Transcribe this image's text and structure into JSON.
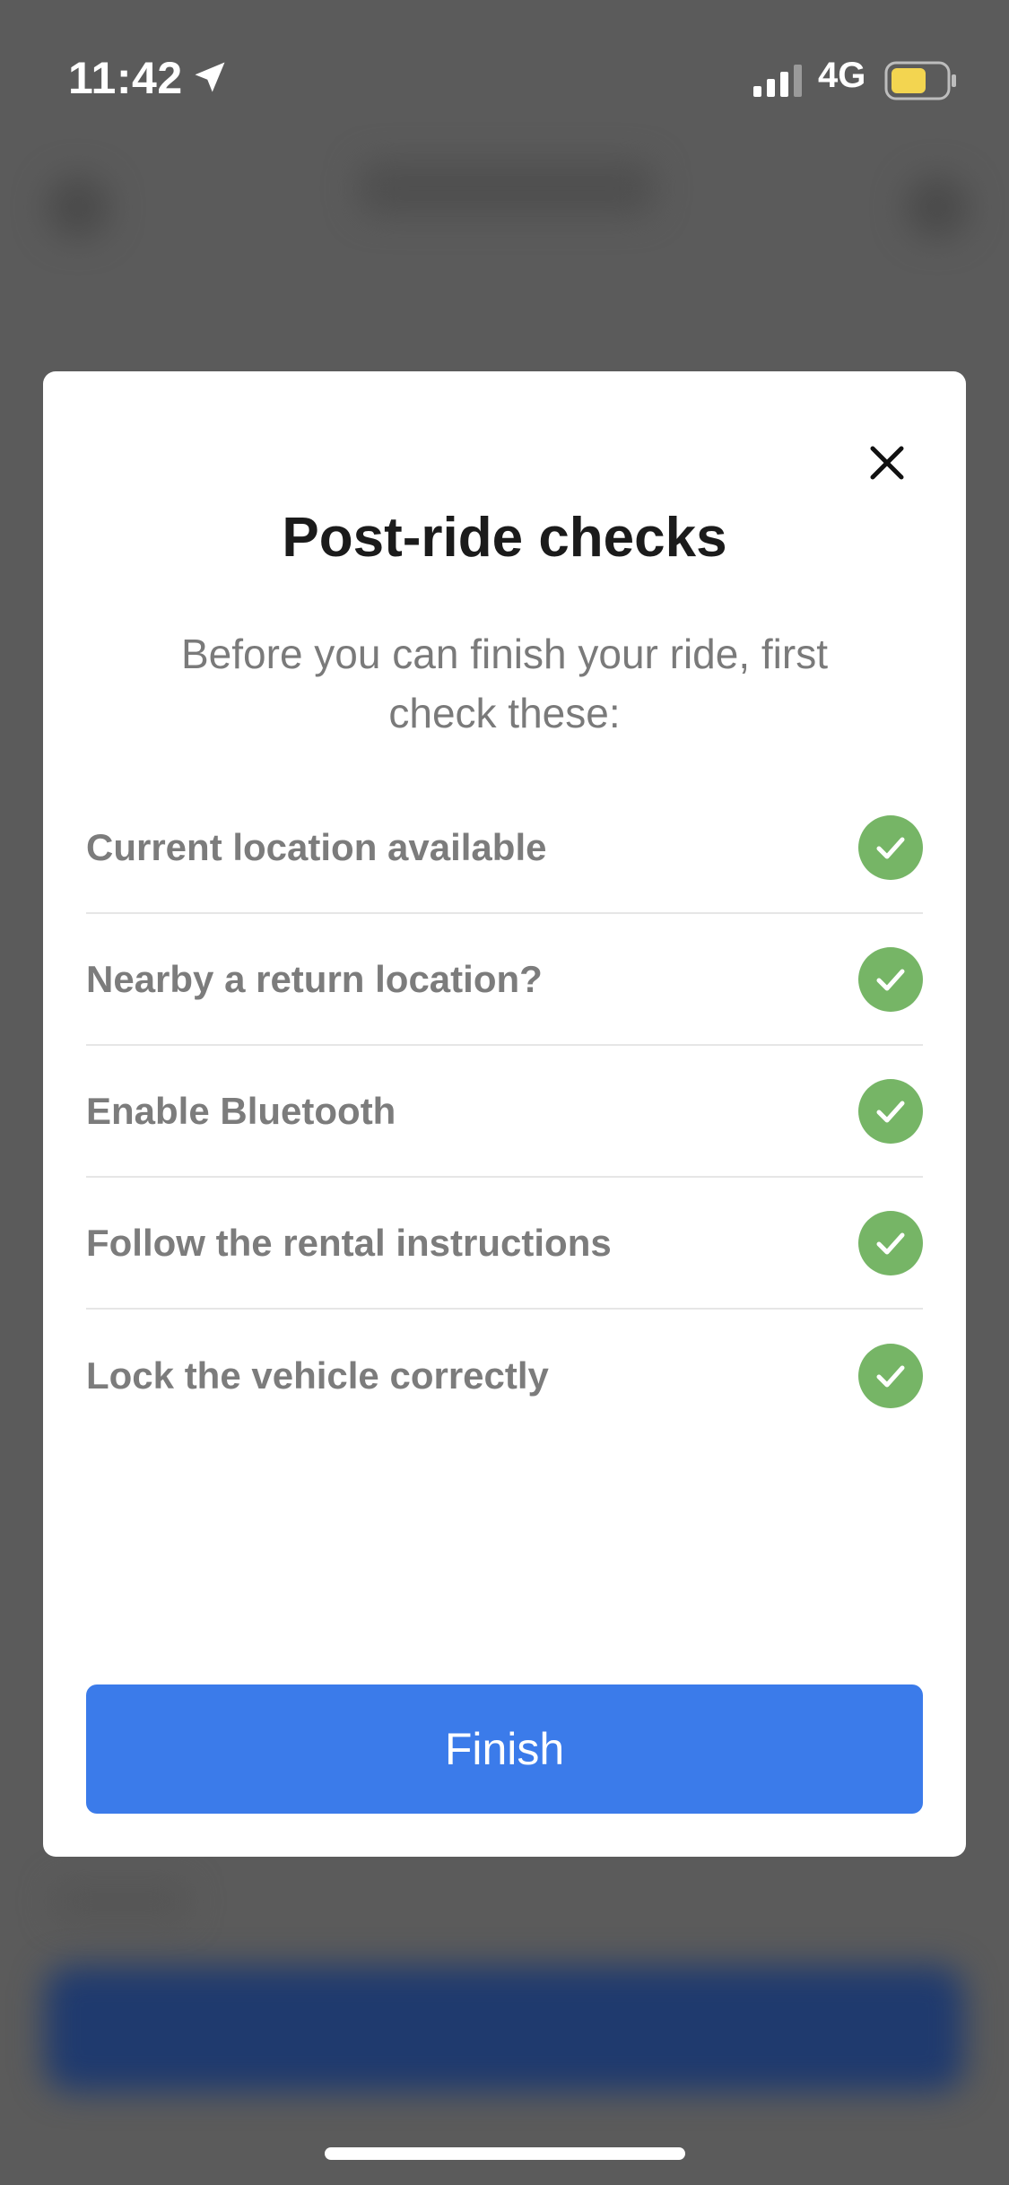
{
  "status_bar": {
    "time": "11:42",
    "network": "4G",
    "battery_color": "#f3d550"
  },
  "modal": {
    "title": "Post-ride checks",
    "subtitle": "Before you can finish your ride, first check these:",
    "checks": [
      {
        "label": "Current location available",
        "status": "passed"
      },
      {
        "label": "Nearby a return location?",
        "status": "passed"
      },
      {
        "label": "Enable Bluetooth",
        "status": "passed"
      },
      {
        "label": "Follow the rental instructions",
        "status": "passed"
      },
      {
        "label": "Lock the vehicle correctly",
        "status": "passed"
      }
    ],
    "finish_label": "Finish",
    "colors": {
      "accent": "#3b7bea",
      "check_ok": "#76b566"
    }
  }
}
